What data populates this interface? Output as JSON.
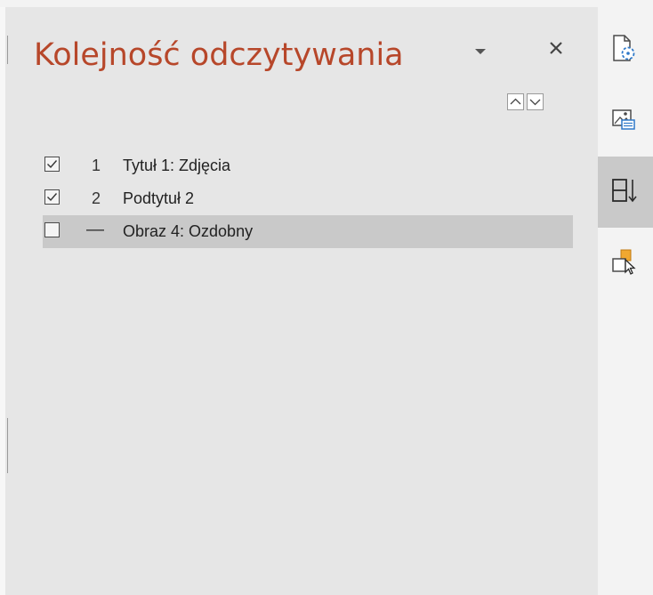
{
  "pane": {
    "title": "Kolejność odczytywania",
    "options_icon": "dropdown-triangle-icon",
    "close_icon": "close-icon",
    "move_up_icon": "chevron-up-icon",
    "move_down_icon": "chevron-down-icon",
    "items": [
      {
        "checked": true,
        "order": "1",
        "label": "Tytuł 1: Zdjęcia",
        "selected": false
      },
      {
        "checked": true,
        "order": "2",
        "label": "Podtytuł 2",
        "selected": false
      },
      {
        "checked": false,
        "order": "—",
        "label": "Obraz 4: Ozdobny",
        "selected": true
      }
    ]
  },
  "rail": {
    "buttons": [
      {
        "icon": "check-accessibility-icon",
        "active": false
      },
      {
        "icon": "alt-text-icon",
        "active": false
      },
      {
        "icon": "reading-order-icon",
        "active": true
      },
      {
        "icon": "selection-pane-icon",
        "active": false
      }
    ]
  },
  "colors": {
    "title": "#b7472a",
    "accent_blue": "#2f79c9",
    "accent_orange": "#f0a830",
    "selection": "#c9c9c9",
    "pane_bg": "#e6e6e6"
  }
}
